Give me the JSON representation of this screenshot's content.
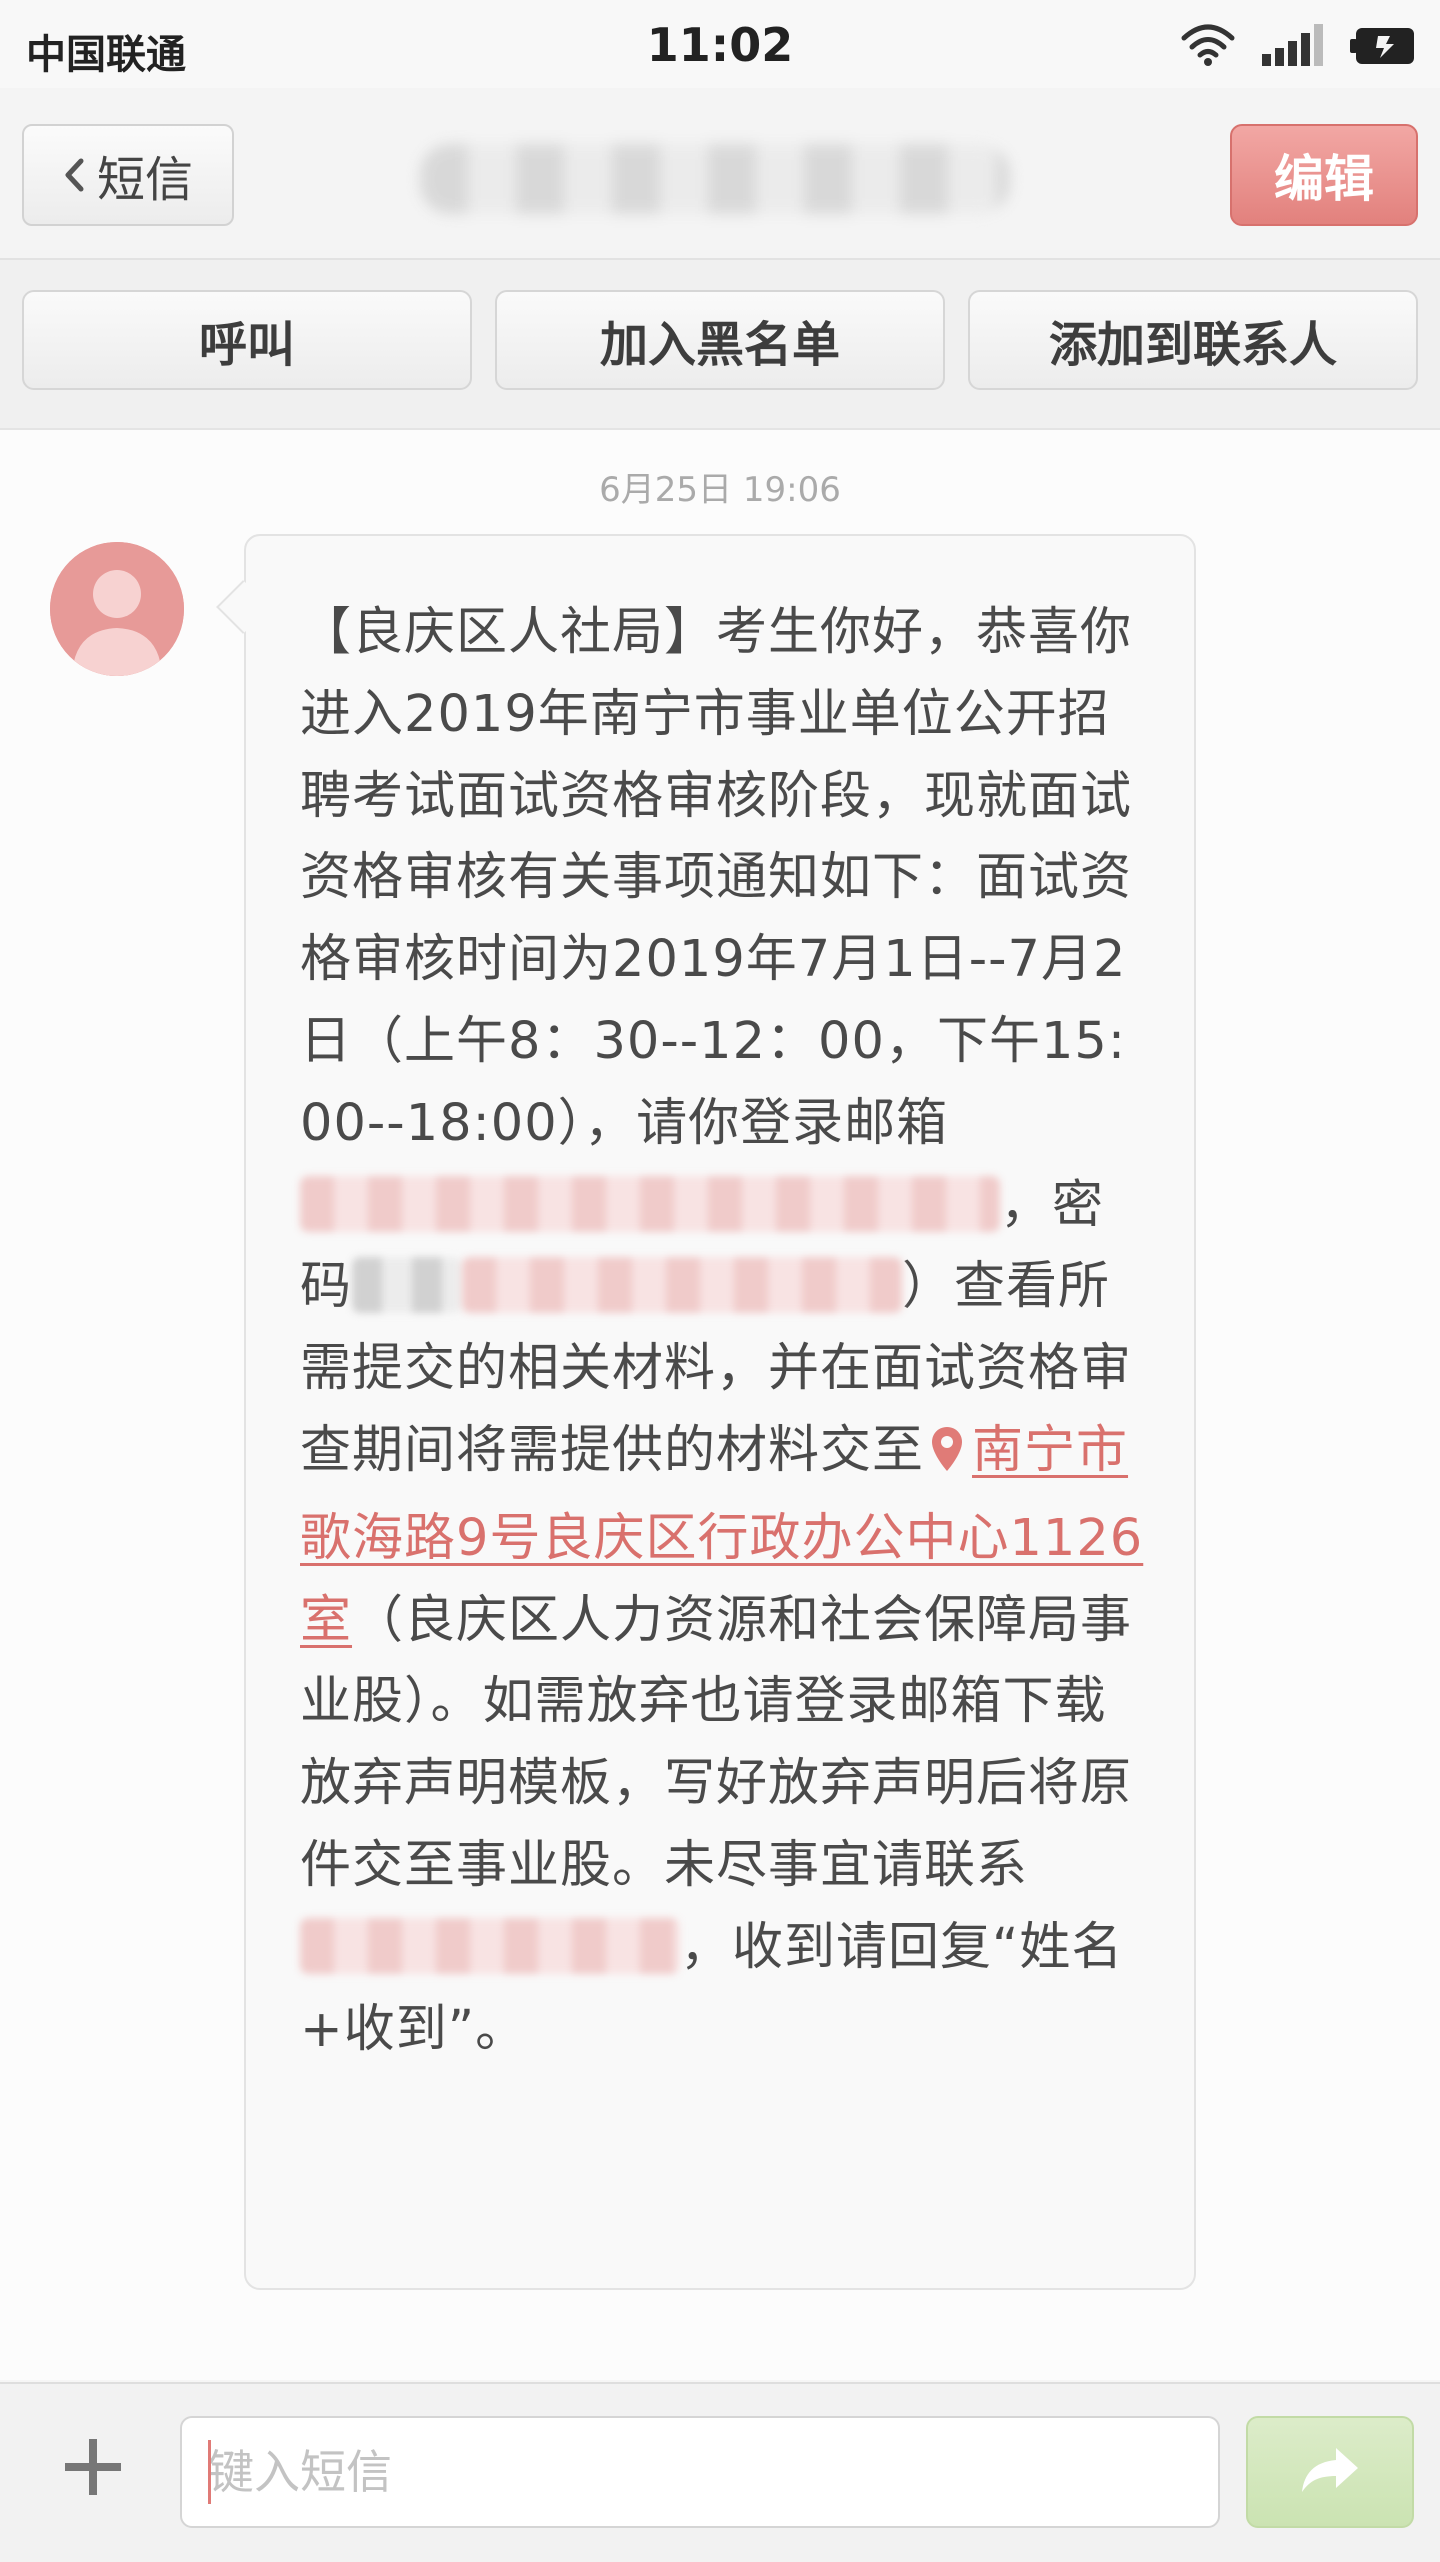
{
  "status_bar": {
    "carrier": "中国联通",
    "time": "11:02"
  },
  "nav": {
    "back_label": "短信",
    "edit_label": "编辑"
  },
  "actions": {
    "call_label": "呼叫",
    "block_label": "加入黑名单",
    "add_contact_label": "添加到联系人"
  },
  "conversation": {
    "timestamp": "6月25日 19:06",
    "message": {
      "part1": "【良庆区人社局】考生你好，恭喜你进入2019年南宁市事业单位公开招聘考试面试资格审核阶段，现就面试资格审核有关事项通知如下：面试资格审核时间为2019年7月1日--7月2日（上午8：30--12：00，下午15:00--18:00），请你登录邮箱",
      "part2": "，密码",
      "part3": "）查看所需提交的相关材料，并在面试资格审查期间将需提供的材料交至",
      "address_link": "南宁市歌海路9号良庆区行政办公中心1126室",
      "part4": "（良庆区人力资源和社会保障局事业股）。如需放弃也请登录邮箱下载放弃声明模板，写好放弃声明后将原件交至事业股。未尽事宜请联系",
      "part5": "，收到请回复“姓名+收到”。"
    }
  },
  "input_bar": {
    "placeholder": "键入短信"
  },
  "colors": {
    "accent": "#e2817d",
    "link": "#d9716d",
    "send": "#cbe3b2"
  },
  "icons": {
    "back": "chevron-left-icon",
    "avatar": "person-icon",
    "pin": "location-pin-icon",
    "plus": "plus-icon",
    "send": "share-arrow-icon",
    "wifi": "wifi-icon",
    "signal": "signal-icon",
    "battery": "battery-icon"
  }
}
